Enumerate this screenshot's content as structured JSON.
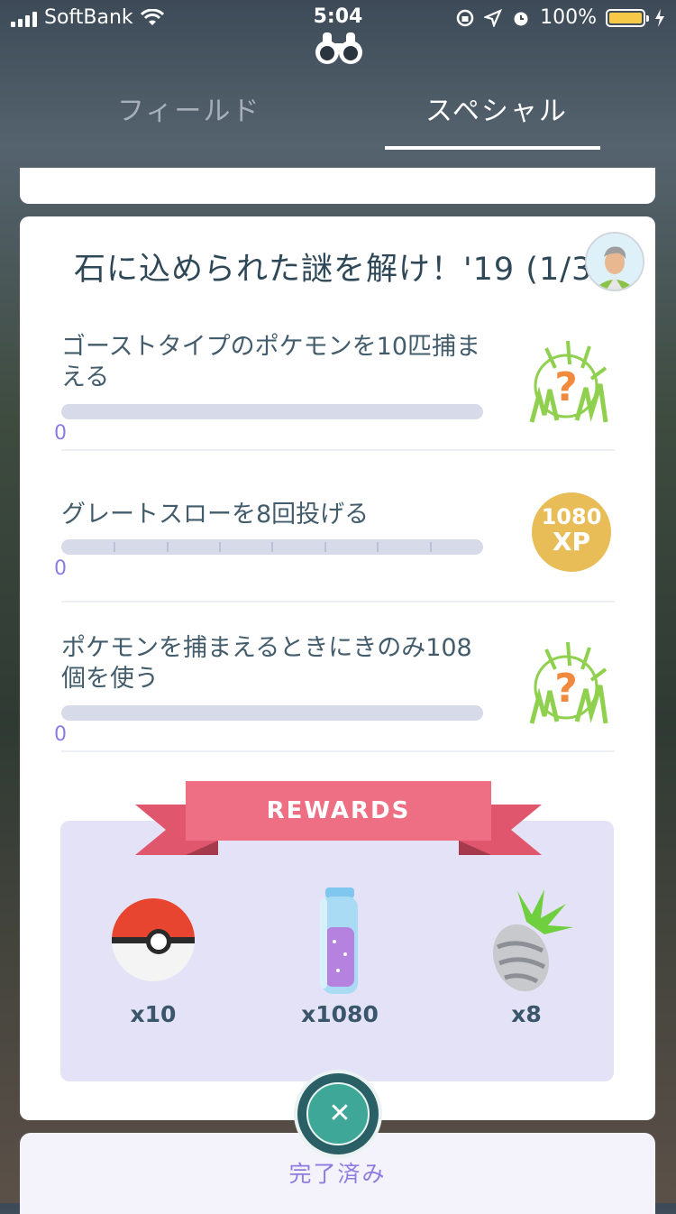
{
  "status_bar": {
    "carrier": "SoftBank",
    "time": "5:04",
    "battery": "100%"
  },
  "tabs": [
    {
      "label": "フィールド"
    },
    {
      "label": "スペシャル"
    }
  ],
  "quest": {
    "title": "石に込められた謎を解け！'19 (1/3"
  },
  "tasks": [
    {
      "text": "ゴーストタイプのポケモンを10匹捕まえる",
      "progress": "0",
      "reward": "question-grass-icon"
    },
    {
      "text": "グレートスローを8回投げる",
      "progress": "0",
      "reward_xp_amount": "1080",
      "reward_xp_unit": "XP"
    },
    {
      "text": "ポケモンを捕まえるときにきのみ108個を使う",
      "progress": "0",
      "reward": "question-grass-icon"
    }
  ],
  "rewards": {
    "label": "REWARDS",
    "items": [
      {
        "icon": "poke-ball-icon",
        "count": "x10"
      },
      {
        "icon": "stardust-icon",
        "count": "x1080"
      },
      {
        "icon": "silver-pinap-berry-icon",
        "count": "x8"
      }
    ]
  },
  "footer": {
    "done_label": "完了済み",
    "close_icon": "close-icon"
  },
  "colors": {
    "accent": "#8e7be0",
    "ribbon": "#ec6b80",
    "xp": "#e8bc57",
    "close": "#3fa797"
  }
}
